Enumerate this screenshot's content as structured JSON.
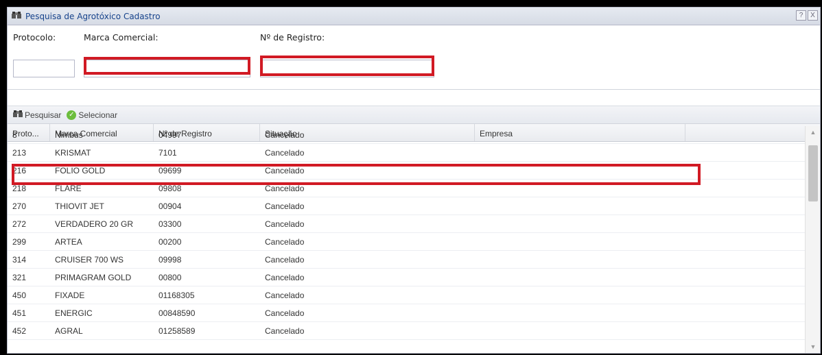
{
  "window": {
    "title": "Pesquisa de Agrotóxico Cadastro",
    "help_label": "?",
    "close_label": "X"
  },
  "form": {
    "protocolo_label": "Protocolo:",
    "marca_label": "Marca Comercial:",
    "registro_label": "Nº de Registro:",
    "protocolo_value": "",
    "marca_value": "",
    "registro_value": ""
  },
  "toolbar": {
    "search_label": "Pesquisar",
    "select_label": "Selecionar"
  },
  "grid": {
    "columns": [
      "Proto...",
      "Marca Comercial",
      "Nº de Registro",
      "Situação",
      "Empresa",
      ""
    ],
    "rows": [
      [
        "8",
        "Nimbus",
        "04997",
        "Cancelado"
      ],
      [
        "213",
        "KRISMAT",
        "7101",
        "Cancelado"
      ],
      [
        "216",
        "FOLIO GOLD",
        "09699",
        "Cancelado"
      ],
      [
        "218",
        "FLARE",
        "09808",
        "Cancelado"
      ],
      [
        "270",
        "THIOVIT JET",
        "00904",
        "Cancelado"
      ],
      [
        "272",
        "VERDADERO 20 GR",
        "03300",
        "Cancelado"
      ],
      [
        "299",
        "ARTEA",
        "00200",
        "Cancelado"
      ],
      [
        "314",
        "CRUISER 700 WS",
        "09998",
        "Cancelado"
      ],
      [
        "321",
        "PRIMAGRAM GOLD",
        "00800",
        "Cancelado"
      ],
      [
        "450",
        "FIXADE",
        "01168305",
        "Cancelado"
      ],
      [
        "451",
        "ENERGIC",
        "00848590",
        "Cancelado"
      ],
      [
        "452",
        "AGRAL",
        "01258589",
        "Cancelado"
      ]
    ]
  },
  "colors": {
    "highlight": "#d11a24",
    "title_text": "#15428b",
    "ok_icon": "#6cbd3d"
  }
}
